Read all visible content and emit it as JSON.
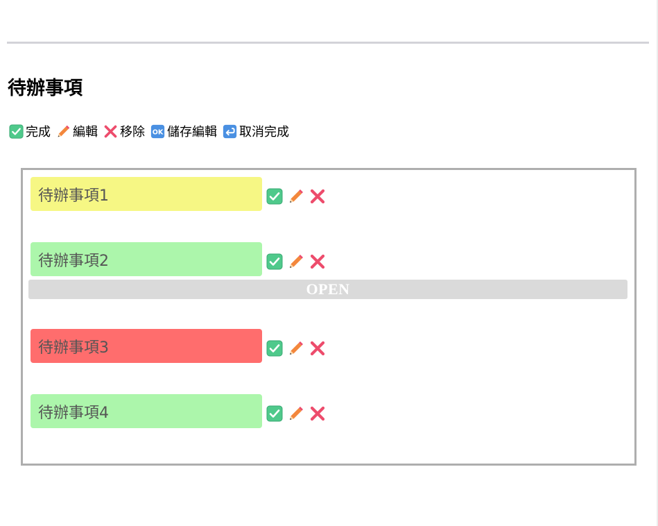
{
  "title": "待辦事項",
  "legend": [
    {
      "icon": "check-box-icon",
      "label": "完成"
    },
    {
      "icon": "pencil-icon",
      "label": "編輯"
    },
    {
      "icon": "cross-icon",
      "label": "移除"
    },
    {
      "icon": "ok-icon",
      "label": "儲存編輯"
    },
    {
      "icon": "return-arrow-icon",
      "label": "取消完成"
    }
  ],
  "todos": [
    {
      "text": "待辦事項1",
      "color": "#f6f784"
    },
    {
      "text": "待辦事項2",
      "color": "#acf6ab"
    },
    {
      "text": "待辦事項3",
      "color": "#ff6d6d"
    },
    {
      "text": "待辦事項4",
      "color": "#acf6ab"
    }
  ],
  "divider_label": "OPEN",
  "colors": {
    "check": "#4fc98b",
    "pencil": "#f3873c",
    "cross": "#ed4c6c",
    "ok": "#4a90e2"
  }
}
